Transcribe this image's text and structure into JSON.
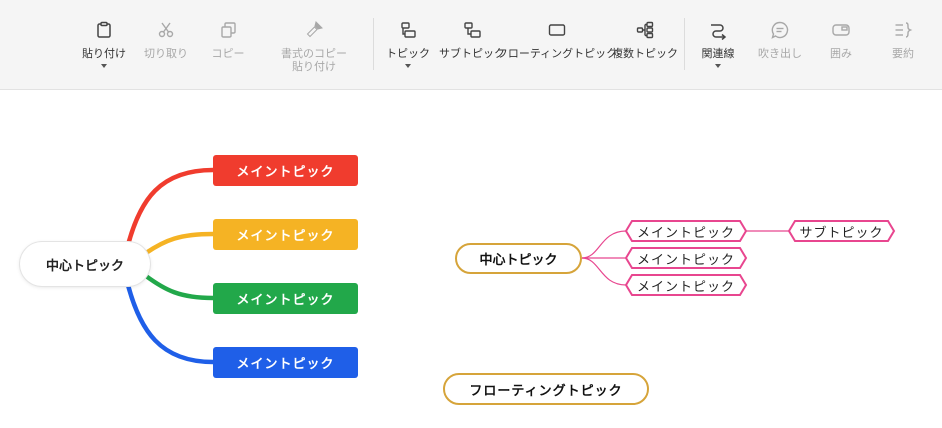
{
  "toolbar": {
    "paste": "貼り付け",
    "cut": "切り取り",
    "copy": "コピー",
    "format_copy_line1": "書式のコピー",
    "format_copy_line2": "貼り付け",
    "topic": "トピック",
    "subtopic": "サブトピック",
    "floating_topic": "フローティングトピック",
    "multiple_topics": "複数トピック",
    "relationship": "関連線",
    "callout": "吹き出し",
    "boundary": "囲み",
    "summary": "要約"
  },
  "map1": {
    "central": "中心トピック",
    "branches": [
      {
        "label": "メイントピック",
        "color": "#f03c2e"
      },
      {
        "label": "メイントピック",
        "color": "#f5b324"
      },
      {
        "label": "メイントピック",
        "color": "#22a84a"
      },
      {
        "label": "メイントピック",
        "color": "#1f5fe8"
      }
    ]
  },
  "map2": {
    "central": "中心トピック",
    "central_border": "#d6a43a",
    "branch_color": "#e8468f",
    "branches": [
      "メイントピック",
      "メイントピック",
      "メイントピック"
    ],
    "subtopic": "サブトピック"
  },
  "floating": {
    "label": "フローティングトピック"
  },
  "icons": {
    "paste": "clipboard-icon",
    "cut": "scissors-icon",
    "copy": "copy-icon",
    "format_copy": "format-brush-icon",
    "topic": "topic-icon",
    "subtopic": "subtopic-icon",
    "floating_topic": "floating-topic-icon",
    "multiple_topics": "multiple-topics-icon",
    "relationship": "relationship-icon",
    "callout": "callout-icon",
    "boundary": "boundary-icon",
    "summary": "summary-icon"
  }
}
